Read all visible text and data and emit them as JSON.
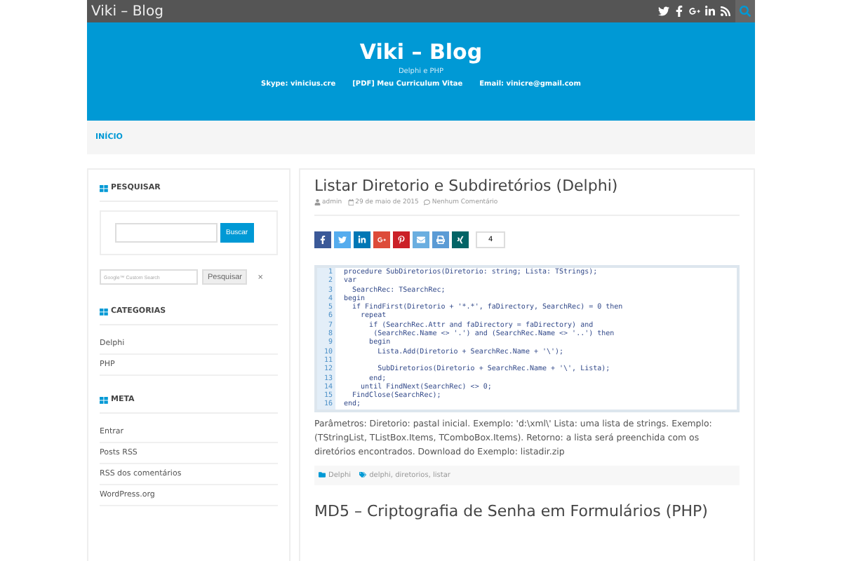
{
  "top_bar": {
    "title": "Viki – Blog",
    "social": [
      {
        "kind": "twitter"
      },
      {
        "kind": "facebook"
      },
      {
        "kind": "google-plus"
      },
      {
        "kind": "linkedin"
      },
      {
        "kind": "rss"
      }
    ]
  },
  "header": {
    "title": "Viki – Blog",
    "tagline": "Delphi e PHP",
    "links": [
      "Skype: vinicius.cre",
      "[PDF] Meu Curriculum Vitae",
      "Email: vinicre@gmail.com"
    ]
  },
  "nav": [
    {
      "label": "INÍCIO",
      "selected": true
    }
  ],
  "sidebar": {
    "search": {
      "title": "PESQUISAR",
      "button": "Buscar"
    },
    "google_search": {
      "placeholder": "Google™ Custom Search",
      "button": "Pesquisar",
      "close": "×"
    },
    "categories": {
      "title": "CATEGORIAS",
      "items": [
        "Delphi",
        "PHP"
      ]
    },
    "meta": {
      "title": "META",
      "items": [
        "Entrar",
        "Posts RSS",
        "RSS dos comentários",
        "WordPress.org"
      ]
    }
  },
  "posts": [
    {
      "title": "Listar Diretorio e Subdiretórios (Delphi)",
      "author": "admin",
      "date": "29 de maio de 2015",
      "comments": "Nenhum Comentário",
      "share": [
        {
          "kind": "facebook",
          "color": "#3b5998"
        },
        {
          "kind": "twitter",
          "color": "#55acee"
        },
        {
          "kind": "linkedin",
          "color": "#0077b5"
        },
        {
          "kind": "google",
          "color": "#dd4b39"
        },
        {
          "kind": "pinterest",
          "color": "#cb2027"
        },
        {
          "kind": "email",
          "color": "#6aaee0"
        },
        {
          "kind": "print",
          "color": "#5b9bd5"
        },
        {
          "kind": "xing",
          "color": "#026466"
        }
      ],
      "share_count": "4",
      "code": [
        {
          "n": "1",
          "text": "procedure SubDiretorios(Diretorio: string; Lista: TStrings);"
        },
        {
          "n": "2",
          "text": "var"
        },
        {
          "n": "3",
          "text": "  SearchRec: TSearchRec;"
        },
        {
          "n": "4",
          "text": "begin"
        },
        {
          "n": "5",
          "text": "  if FindFirst(Diretorio + '*.*', faDirectory, SearchRec) = 0 then"
        },
        {
          "n": "6",
          "text": "    repeat"
        },
        {
          "n": "7",
          "text": "      if (SearchRec.Attr and faDirectory = faDirectory) and"
        },
        {
          "n": "8",
          "text": "       (SearchRec.Name <> '.') and (SearchRec.Name <> '..') then"
        },
        {
          "n": "9",
          "text": "      begin"
        },
        {
          "n": "10",
          "text": "        Lista.Add(Diretorio + SearchRec.Name + '\\');"
        },
        {
          "n": "11"
        },
        {
          "n": "12",
          "text": "        SubDiretorios(Diretorio + SearchRec.Name + '\\', Lista);"
        },
        {
          "n": "13",
          "text": "      end;"
        },
        {
          "n": "14",
          "text": "    until FindNext(SearchRec) <> 0;"
        },
        {
          "n": "15",
          "text": "  FindClose(SearchRec);"
        },
        {
          "n": "16",
          "text": "end;"
        }
      ],
      "body": "Parâmetros: Diretorio: pastal inicial. Exemplo: 'd:\\xml\\' Lista: uma lista de strings. Exemplo: (TStringList, TListBox.Items, TComboBox.Items). Retorno: a lista será preenchida com os diretórios encontrados. Download do Exemplo: listadir.zip",
      "category": "Delphi",
      "tags": "delphi, diretorios, listar"
    },
    {
      "title": "MD5 – Criptografia de Senha em Formulários (PHP)"
    }
  ]
}
